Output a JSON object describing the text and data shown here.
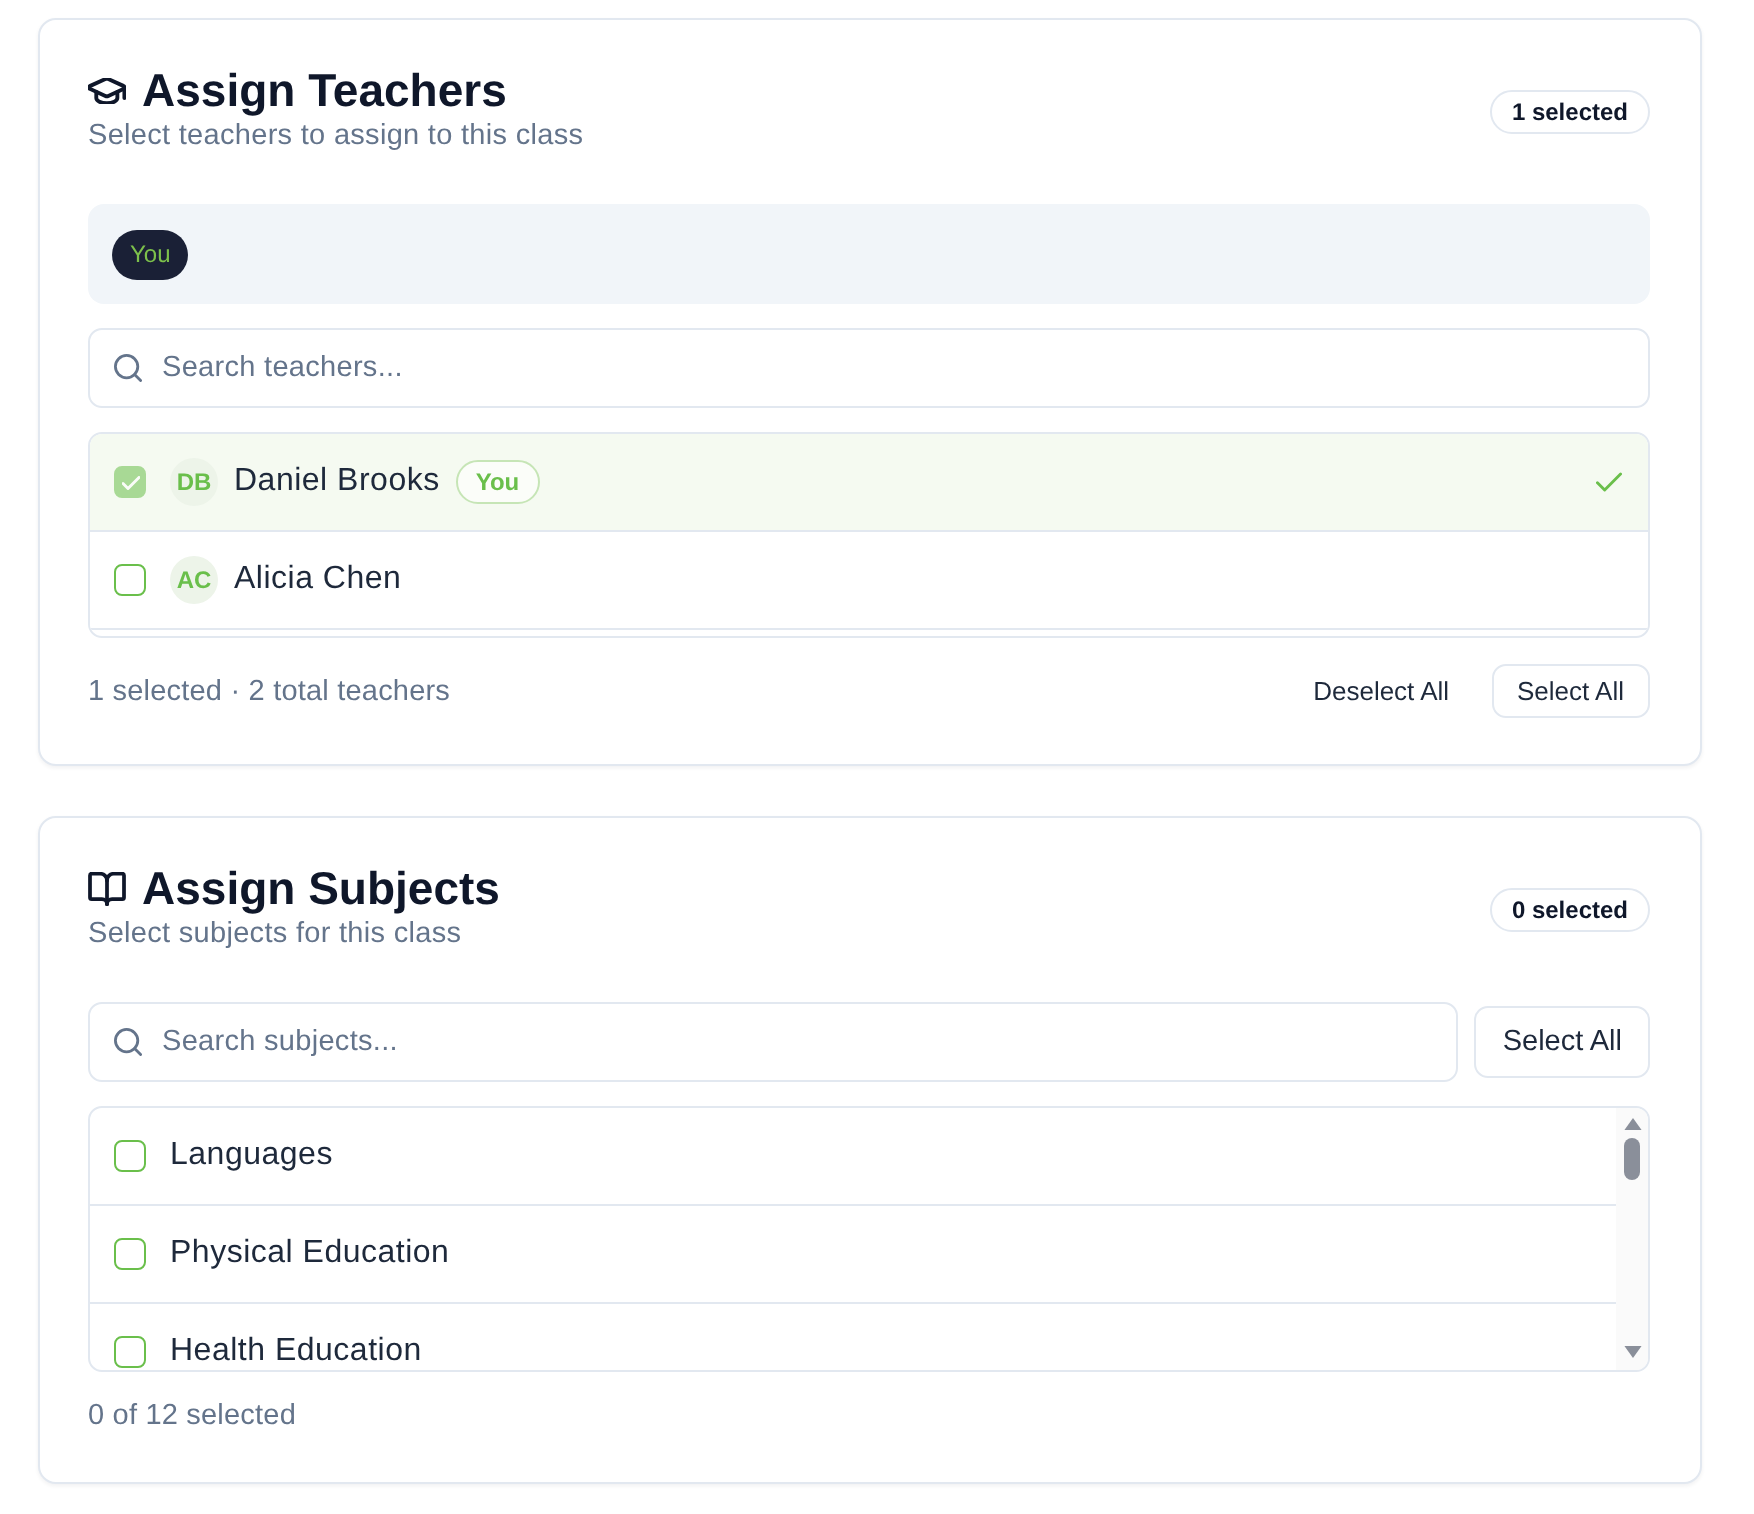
{
  "teachers_card": {
    "title": "Assign Teachers",
    "subtitle": "Select teachers to assign to this class",
    "badge": "1 selected",
    "selected_chips": [
      {
        "label": "You"
      }
    ],
    "search": {
      "placeholder": "Search teachers..."
    },
    "rows": [
      {
        "initials": "DB",
        "name": "Daniel Brooks",
        "tag": "You",
        "checked": true,
        "disabled": true
      },
      {
        "initials": "AC",
        "name": "Alicia Chen",
        "checked": false,
        "disabled": false
      }
    ],
    "summary": "1 selected · 2 total teachers",
    "buttons": [
      {
        "label": "Deselect All",
        "kind": "ghost"
      },
      {
        "label": "Select All",
        "kind": "outline"
      }
    ]
  },
  "subjects_card": {
    "title": "Assign Subjects",
    "subtitle": "Select subjects for this class",
    "badge": "0 selected",
    "search": {
      "placeholder": "Search subjects..."
    },
    "select_all_button": "Select All",
    "rows": [
      {
        "name": "Languages",
        "checked": false
      },
      {
        "name": "Physical Education",
        "checked": false
      },
      {
        "name": "Health Education",
        "checked": false
      }
    ],
    "summary": "0 of 12 selected"
  }
}
